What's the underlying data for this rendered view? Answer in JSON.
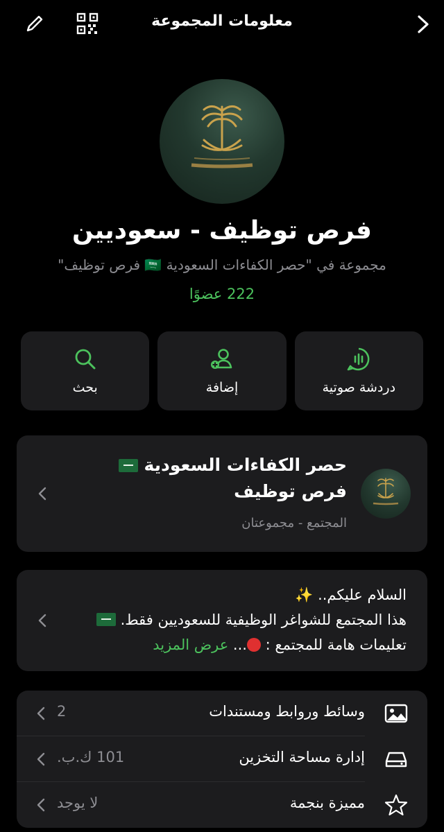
{
  "header": {
    "title": "معلومات المجموعة"
  },
  "group": {
    "name": "فرص توظيف - سعوديين",
    "subtitle": "مجموعة في \"حصر الكفاءات السعودية 🇸🇦 فرص توظيف\"",
    "members": "222 عضوًا"
  },
  "actions": [
    {
      "label": "دردشة صوتية",
      "icon": "voice-chat-icon"
    },
    {
      "label": "إضافة",
      "icon": "add-person-icon"
    },
    {
      "label": "بحث",
      "icon": "search-icon"
    }
  ],
  "community": {
    "title_line1": "حصر الكفاءات السعودية",
    "title_line2": "فرص توظيف",
    "subtitle": "المجتمع - مجموعتان"
  },
  "description": {
    "line1": "السلام عليكم..",
    "line2": "هذا المجتمع للشواغر الوظيفية للسعوديين فقط.",
    "line3_prefix": "تعليمات هامة للمجتمع :",
    "line3_suffix": "...",
    "more": "عرض المزيد"
  },
  "rows": [
    {
      "label": "وسائط وروابط ومستندات",
      "value": "2",
      "icon": "photo-icon"
    },
    {
      "label": "إدارة مساحة التخزين",
      "value": "101 ك.ب.",
      "icon": "storage-icon"
    },
    {
      "label": "مميزة بنجمة",
      "value": "لا يوجد",
      "icon": "star-icon"
    }
  ],
  "colors": {
    "accent": "#4cc25d",
    "background": "#000000",
    "card": "#1c1c1e",
    "secondary_text": "#8e8e93"
  }
}
